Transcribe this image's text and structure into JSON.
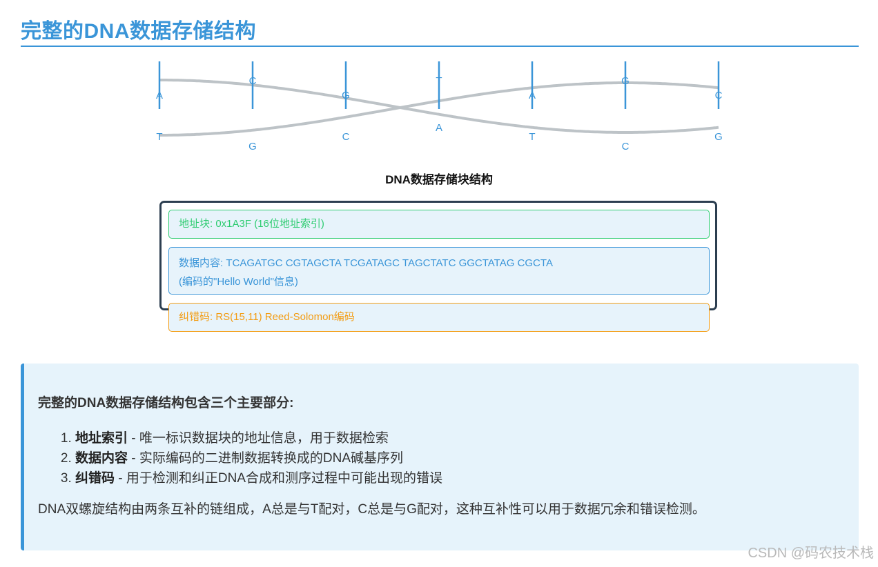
{
  "page": {
    "title": "完整的DNA数据存储结构"
  },
  "chart_data": {
    "type": "diagram",
    "helix": {
      "top_strand": [
        "A",
        "C",
        "G",
        "T",
        "A",
        "G",
        "C"
      ],
      "bottom_strand": [
        "T",
        "G",
        "C",
        "A",
        "T",
        "C",
        "G"
      ]
    }
  },
  "block": {
    "title": "DNA数据存储块结构",
    "address": "地址块: 0x1A3F (16位地址索引)",
    "data_line1": "数据内容: TCAGATGC CGTAGCTA TCGATAGC TAGCTATC GGCTATAG CGCTA",
    "data_line2": "(编码的\"Hello World\"信息)",
    "ecc": "纠错码: RS(15,11) Reed-Solomon编码"
  },
  "info": {
    "heading": "完整的DNA数据存储结构包含三个主要部分:",
    "items": [
      {
        "term": "地址索引",
        "desc": " - 唯一标识数据块的地址信息，用于数据检索"
      },
      {
        "term": "数据内容",
        "desc": " - 实际编码的二进制数据转换成的DNA碱基序列"
      },
      {
        "term": "纠错码",
        "desc": " - 用于检测和纠正DNA合成和测序过程中可能出现的错误"
      }
    ],
    "note": "DNA双螺旋结构由两条互补的链组成，A总是与T配对，C总是与G配对，这种互补性可以用于数据冗余和错误检测。"
  },
  "watermark": "CSDN @码农技术栈",
  "colors": {
    "accent": "#3a95d8",
    "strand": "#bdc3c7",
    "address": "#2ecc71",
    "ecc": "#f39c12",
    "frame": "#2c3e50"
  }
}
